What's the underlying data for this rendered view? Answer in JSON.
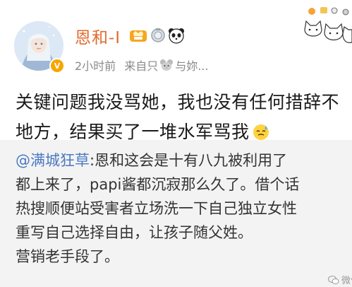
{
  "post": {
    "username": "恩和-I",
    "time": "2小时前",
    "source_prefix": "来自只",
    "source_suffix": "与妳...",
    "text_lines": [
      "关键问题我没骂她，我也没有任何措辞不",
      "地方，结果买了一堆水军骂我"
    ],
    "emoji_icon": "sweat-smile-icon"
  },
  "repost": {
    "mention": "@满城狂草",
    "first_line_rest": ":恩和这会是十有八九被利用了",
    "lines": [
      "都上来了，papi酱都沉寂那么久了。借个话",
      "热搜顺便站受害者立场洗一下自己独立女性",
      "重写自己选择自由，让孩子随父姓。",
      "营销老手段了。"
    ]
  },
  "watermark": {
    "label": "微信"
  },
  "colors": {
    "username": "#e16a2e",
    "mention": "#4a78c2",
    "meta": "#8a8a8a",
    "repost_bg": "#f3f3f3"
  }
}
